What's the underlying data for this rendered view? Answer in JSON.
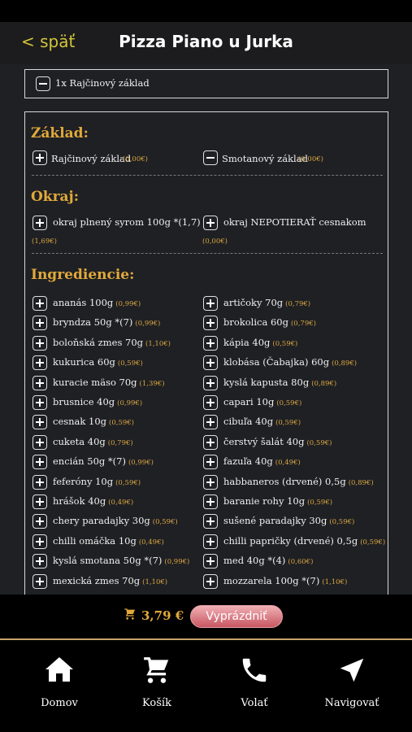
{
  "header": {
    "back_label": "< späť",
    "title": "Pizza Piano u Jurka"
  },
  "selected": [
    {
      "label": "1x Rajčinový základ"
    }
  ],
  "sections": {
    "zaklad": {
      "title": "Základ:",
      "items": [
        {
          "label": "Rajčinový základ",
          "price": "(0,00€)"
        },
        {
          "label": "Smotanový základ",
          "price": "(0,00€)"
        }
      ]
    },
    "okraj": {
      "title": "Okraj:",
      "items": [
        {
          "label": "okraj plnený syrom 100g *(1,7)",
          "price": "(1,69€)"
        },
        {
          "label": "okraj NEPOTIERAŤ cesnakom",
          "price": "(0,00€)"
        }
      ]
    },
    "ingrediencie": {
      "title": "Ingredien­cie:",
      "left": [
        {
          "label": "ananás 100g",
          "price": "(0,99€)"
        },
        {
          "label": "bryndza 50g *(7)",
          "price": "(0,99€)"
        },
        {
          "label": "boloňská zmes 70g",
          "price": "(1,10€)"
        },
        {
          "label": "kukurica 60g",
          "price": "(0,59€)"
        },
        {
          "label": "kuracie mäso 70g",
          "price": "(1,39€)"
        },
        {
          "label": "brusnice 40g",
          "price": "(0,99€)"
        },
        {
          "label": "cesnak 10g",
          "price": "(0,59€)"
        },
        {
          "label": "cuketa 40g",
          "price": "(0,79€)"
        },
        {
          "label": "encián 50g *(7)",
          "price": "(0,99€)"
        },
        {
          "label": "feferóny 10g",
          "price": "(0,59€)"
        },
        {
          "label": "hrášok 40g",
          "price": "(0,49€)"
        },
        {
          "label": "chery paradajky 30g",
          "price": "(0,59€)"
        },
        {
          "label": "chilli omáčka 10g",
          "price": "(0,49€)"
        },
        {
          "label": "kyslá smotana 50g *(7)",
          "price": "(0,99€)"
        },
        {
          "label": "mexická zmes 70g",
          "price": "(1,10€)"
        }
      ],
      "right": [
        {
          "label": "artičoky 70g",
          "price": "(0,79€)"
        },
        {
          "label": "brokolica 60g",
          "price": "(0,79€)"
        },
        {
          "label": "kápia 40g",
          "price": "(0,59€)"
        },
        {
          "label": "klobása (Čabajka) 60g",
          "price": "(0,89€)"
        },
        {
          "label": "kyslá kapusta 80g",
          "price": "(0,89€)"
        },
        {
          "label": "capari 10g",
          "price": "(0,59€)"
        },
        {
          "label": "cibuľa 40g",
          "price": "(0,59€)"
        },
        {
          "label": "čerstvý šalát 40g",
          "price": "(0,59€)"
        },
        {
          "label": "fazuľa 40g",
          "price": "(0,49€)"
        },
        {
          "label": "habbaneros (drvené) 0,5g",
          "price": "(0,89€)"
        },
        {
          "label": "baranie rohy 10g",
          "price": "(0,59€)"
        },
        {
          "label": "sušené paradajky 30g",
          "price": "(0,59€)"
        },
        {
          "label": "chilli papričky (drvené) 0,5g",
          "price": "(0,59€)"
        },
        {
          "label": "med 40g *(4)",
          "price": "(0,60€)"
        },
        {
          "label": "mozzarela 100g *(7)",
          "price": "(1,10€)"
        }
      ]
    }
  },
  "cart": {
    "total": "3,79 €",
    "empty_label": "Vyprázdniť"
  },
  "tabs": [
    {
      "label": "Domov",
      "icon": "home-icon"
    },
    {
      "label": "Košík",
      "icon": "cart-icon"
    },
    {
      "label": "Volať",
      "icon": "phone-icon"
    },
    {
      "label": "Navigovať",
      "icon": "navigation-icon"
    }
  ]
}
